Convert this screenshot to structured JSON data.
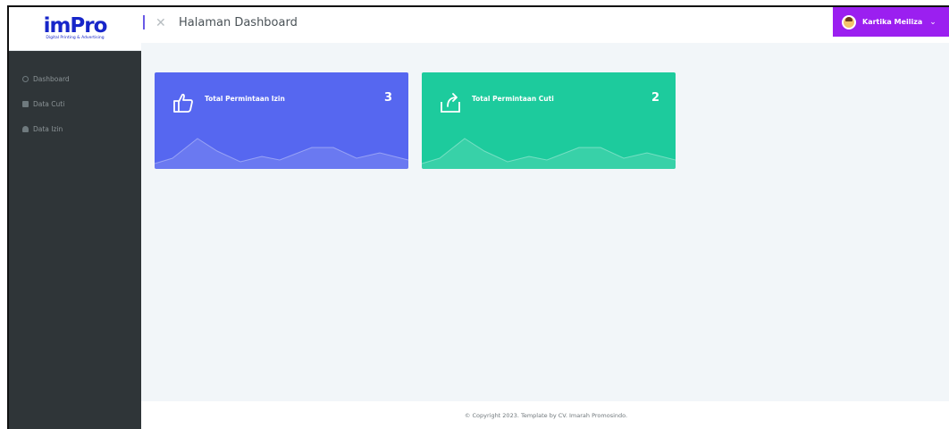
{
  "brand": {
    "logo_text": "imPro",
    "logo_tagline": "Digital Printing & Advertising"
  },
  "sidebar": {
    "items": [
      {
        "label": "Dashboard",
        "icon": "dashboard-icon"
      },
      {
        "label": "Data Cuti",
        "icon": "calendar-icon"
      },
      {
        "label": "Data Izin",
        "icon": "document-icon"
      }
    ]
  },
  "header": {
    "title": "Halaman Dashboard",
    "toggle_icon": "close-icon",
    "user_name": "Kartika Meiliza"
  },
  "cards": [
    {
      "label": "Total Permintaan Izin",
      "count": "3",
      "icon": "thumbs-up-icon",
      "color": "#5667f0"
    },
    {
      "label": "Total Permintaan Cuti",
      "count": "2",
      "icon": "share-icon",
      "color": "#1dcb9d"
    }
  ],
  "footer": {
    "copyright": "© Copyright 2023. Template by CV. Imarah Promosindo."
  },
  "colors": {
    "sidebar": "#2f3538",
    "accent_user": "#9b1ff0",
    "background": "#f2f6f9"
  }
}
